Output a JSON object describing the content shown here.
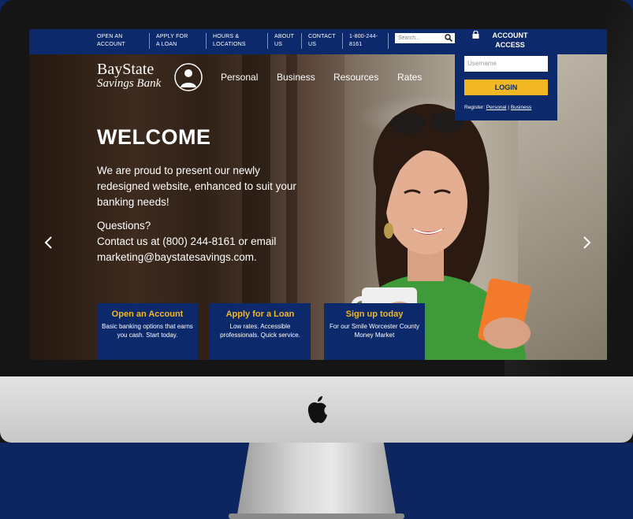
{
  "top_nav": {
    "items": [
      {
        "label": "OPEN AN\nACCOUNT"
      },
      {
        "label": "APPLY FOR\nA LOAN"
      },
      {
        "label": "HOURS &\nLOCATIONS"
      },
      {
        "label": "ABOUT\nUS"
      },
      {
        "label": "CONTACT\nUS"
      },
      {
        "label": "1-800-244-\n8161"
      }
    ],
    "search_placeholder": "Search..."
  },
  "account_access": {
    "title": "ACCOUNT\nACCESS",
    "username_placeholder": "Username",
    "login_label": "LOGIN",
    "register_label": "Register:",
    "register_personal": "Personal",
    "register_business": "Business"
  },
  "logo": {
    "line1": "BayState",
    "line2": "Savings Bank"
  },
  "main_nav": [
    {
      "label": "Personal"
    },
    {
      "label": "Business"
    },
    {
      "label": "Resources"
    },
    {
      "label": "Rates"
    }
  ],
  "hero": {
    "title": "WELCOME",
    "paragraph": "We are proud to present our newly redesigned website, enhanced to suit your banking needs!",
    "questions": "Questions?",
    "contact": "Contact us at  (800) 244-8161 or email marketing@baystatesavings.com."
  },
  "promos": [
    {
      "title": "Open an Account",
      "body": "Basic banking options that earns you cash. Start today."
    },
    {
      "title": "Apply for a Loan",
      "body": "Low rates. Accessible professionals. Quick service."
    },
    {
      "title": "Sign up today",
      "body": "For our Smile Worcester County Money Market"
    }
  ],
  "colors": {
    "navy": "#0c2a6b",
    "gold": "#f2b824",
    "background": "#0d2660"
  }
}
